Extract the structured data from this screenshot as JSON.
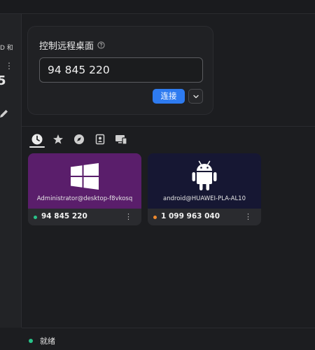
{
  "sidebar": {
    "partial_text": "D 和",
    "partial_big": "5"
  },
  "control_card": {
    "title": "控制远程桌面",
    "id_value": "94 845 220",
    "connect_label": "连接"
  },
  "tabs": [
    {
      "name": "recent",
      "icon": "clock-icon",
      "active": true
    },
    {
      "name": "favorites",
      "icon": "star-icon",
      "active": false
    },
    {
      "name": "discovered",
      "icon": "compass-icon",
      "active": false
    },
    {
      "name": "address-book",
      "icon": "contact-icon",
      "active": false
    },
    {
      "name": "devices",
      "icon": "devices-icon",
      "active": false
    }
  ],
  "peers": [
    {
      "user": "Administrator@desktop-f8vkosq",
      "id": "94 845 220",
      "platform": "windows",
      "banner_color": "#5a1e6b",
      "status_color": "#29c48a"
    },
    {
      "user": "android@HUAWEI-PLA-AL10",
      "id": "1 099 963 040",
      "platform": "android",
      "banner_color": "#161733",
      "status_color": "#f08a2e"
    }
  ],
  "status": {
    "text": "就绪",
    "color": "#29c48a"
  },
  "colors": {
    "accent": "#2e7bf0",
    "background": "#1c1d20"
  }
}
